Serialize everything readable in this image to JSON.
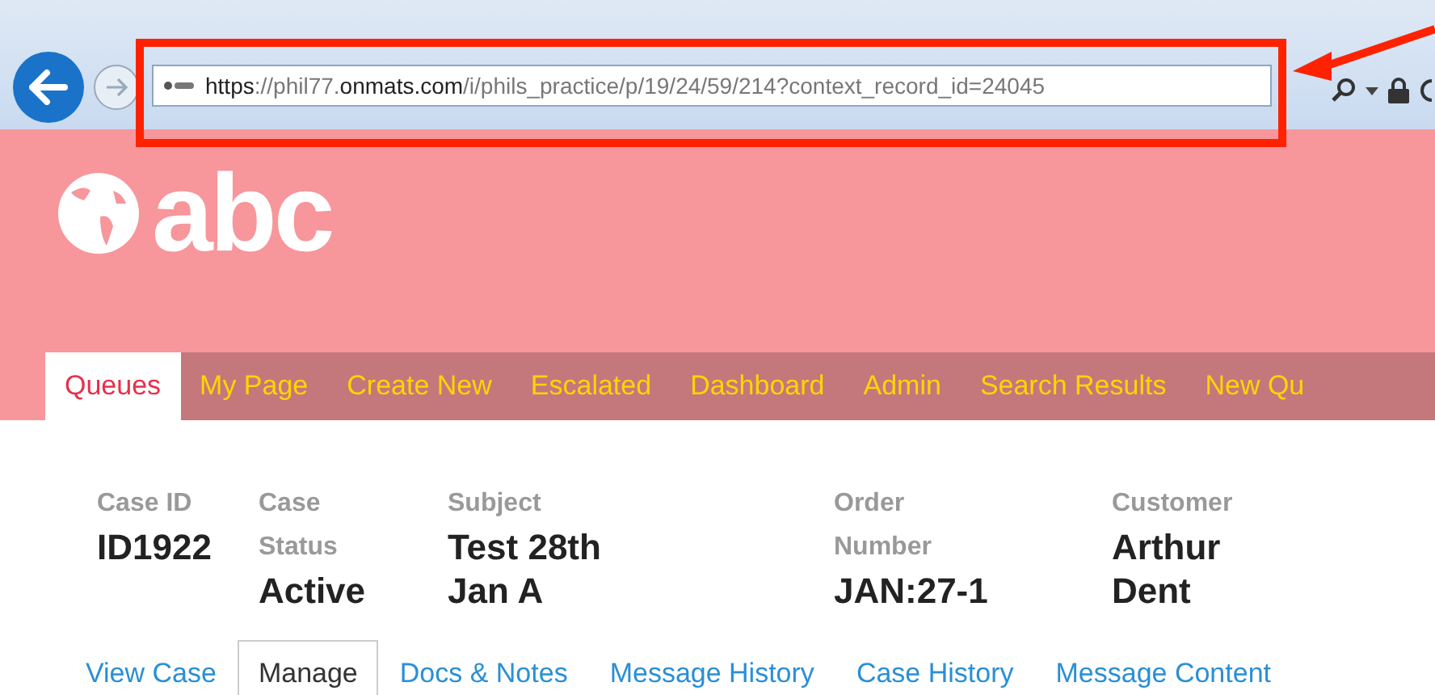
{
  "browser": {
    "url_parts": [
      {
        "text": "https",
        "strong": true
      },
      {
        "text": "://phil77.",
        "strong": false
      },
      {
        "text": "onmats.com",
        "strong": true
      },
      {
        "text": "/i/phils_practice/p/19/24/59/214?context_record_id=24045",
        "strong": false
      }
    ]
  },
  "header": {
    "logo_text": "abc"
  },
  "nav": [
    {
      "label": "Queues",
      "selected": true
    },
    {
      "label": "My Page",
      "selected": false
    },
    {
      "label": "Create New",
      "selected": false
    },
    {
      "label": "Escalated",
      "selected": false
    },
    {
      "label": "Dashboard",
      "selected": false
    },
    {
      "label": "Admin",
      "selected": false
    },
    {
      "label": "Search Results",
      "selected": false
    },
    {
      "label": "New Qu",
      "selected": false
    }
  ],
  "case_fields": [
    {
      "label": "Case ID",
      "value": "ID1922"
    },
    {
      "label": "Case Status",
      "value": "Active"
    },
    {
      "label": "Subject",
      "value": "Test 28th Jan A"
    },
    {
      "label": "Order Number",
      "value": "JAN:27-1"
    },
    {
      "label": "Customer",
      "value": "Arthur Dent"
    }
  ],
  "case_tabs": [
    {
      "label": "View Case",
      "selected": false
    },
    {
      "label": "Manage",
      "selected": true
    },
    {
      "label": "Docs & Notes",
      "selected": false
    },
    {
      "label": "Message History",
      "selected": false
    },
    {
      "label": "Case History",
      "selected": false
    },
    {
      "label": "Message Content",
      "selected": false
    }
  ]
}
